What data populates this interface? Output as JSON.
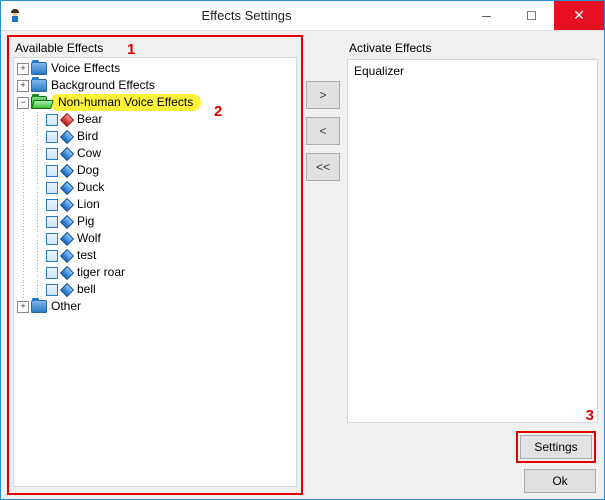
{
  "window": {
    "title": "Effects Settings"
  },
  "annotations": {
    "m1": "1",
    "m2": "2",
    "m3": "3"
  },
  "left": {
    "label": "Available Effects",
    "tree": {
      "voice": "Voice Effects",
      "background": "Background Effects",
      "nonhuman": {
        "label": "Non-human Voice Effects",
        "children": [
          "Bear",
          "Bird",
          "Cow",
          "Dog",
          "Duck",
          "Lion",
          "Pig",
          "Wolf",
          "test",
          "tiger roar",
          "bell"
        ]
      },
      "other": "Other"
    }
  },
  "transfer": {
    "add": ">",
    "remove": "<",
    "remove_all": "<<"
  },
  "right": {
    "label": "Activate Effects",
    "items": [
      "Equalizer"
    ]
  },
  "buttons": {
    "settings": "Settings",
    "ok": "Ok"
  }
}
